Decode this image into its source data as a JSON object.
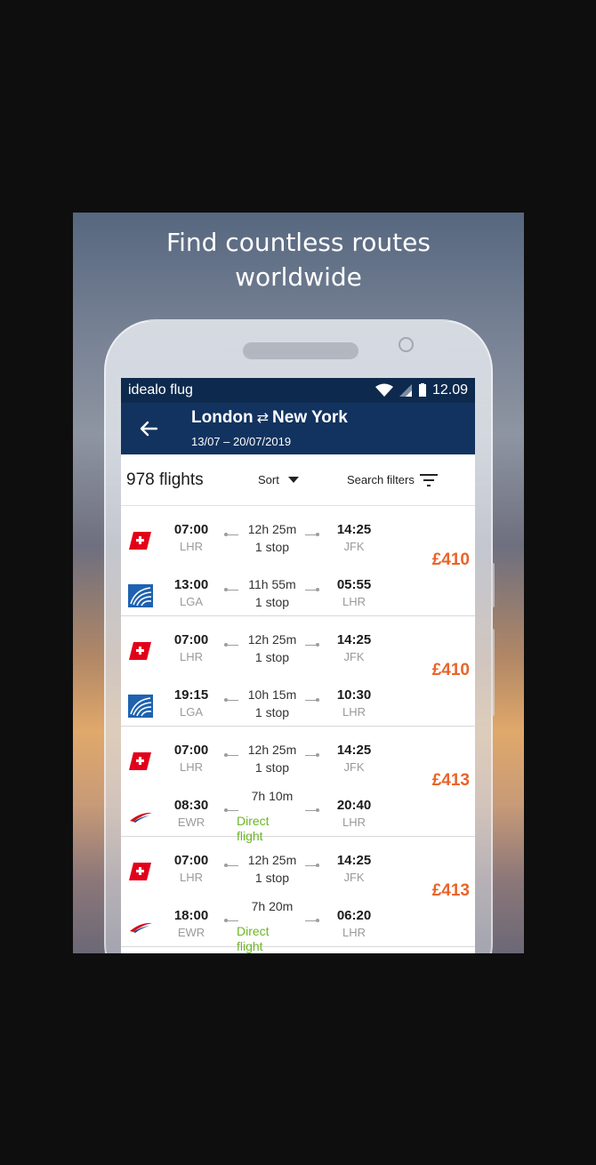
{
  "headline": {
    "line1": "Find countless routes",
    "line2": "worldwide"
  },
  "statusbar": {
    "app_name": "idealo flug",
    "time": "12.09"
  },
  "header": {
    "origin": "London",
    "swap_symbol": "⇄",
    "destination": "New York",
    "dates": "13/07  –  20/07/2019"
  },
  "toolbar": {
    "count": "978 flights",
    "sort_label": "Sort",
    "filters_label": "Search filters"
  },
  "colors": {
    "appbar": "#12335f",
    "statusbar": "#0d2a4e",
    "price": "#e8642a",
    "direct": "#6cb626"
  },
  "results": [
    {
      "price": "£410",
      "outbound": {
        "airline_icon": "swiss-logo-icon",
        "dep_time": "07:00",
        "dep_airport": "LHR",
        "duration": "12h 25m",
        "stops": "1 stop",
        "arr_time": "14:25",
        "arr_airport": "JFK"
      },
      "return": {
        "airline_icon": "united-logo-icon",
        "dep_time": "13:00",
        "dep_airport": "LGA",
        "duration": "11h 55m",
        "stops": "1 stop",
        "arr_time": "05:55",
        "arr_airport": "LHR"
      }
    },
    {
      "price": "£410",
      "outbound": {
        "airline_icon": "swiss-logo-icon",
        "dep_time": "07:00",
        "dep_airport": "LHR",
        "duration": "12h 25m",
        "stops": "1 stop",
        "arr_time": "14:25",
        "arr_airport": "JFK"
      },
      "return": {
        "airline_icon": "united-logo-icon",
        "dep_time": "19:15",
        "dep_airport": "LGA",
        "duration": "10h 15m",
        "stops": "1 stop",
        "arr_time": "10:30",
        "arr_airport": "LHR"
      }
    },
    {
      "price": "£413",
      "outbound": {
        "airline_icon": "swiss-logo-icon",
        "dep_time": "07:00",
        "dep_airport": "LHR",
        "duration": "12h 25m",
        "stops": "1 stop",
        "arr_time": "14:25",
        "arr_airport": "JFK"
      },
      "return": {
        "airline_icon": "british-airways-logo-icon",
        "dep_time": "08:30",
        "dep_airport": "EWR",
        "duration": "7h 10m",
        "stops": "Direct flight",
        "arr_time": "20:40",
        "arr_airport": "LHR"
      }
    },
    {
      "price": "£413",
      "outbound": {
        "airline_icon": "swiss-logo-icon",
        "dep_time": "07:00",
        "dep_airport": "LHR",
        "duration": "12h 25m",
        "stops": "1 stop",
        "arr_time": "14:25",
        "arr_airport": "JFK"
      },
      "return": {
        "airline_icon": "british-airways-logo-icon",
        "dep_time": "18:00",
        "dep_airport": "EWR",
        "duration": "7h 20m",
        "stops": "Direct flight",
        "arr_time": "06:20",
        "arr_airport": "LHR"
      }
    }
  ]
}
